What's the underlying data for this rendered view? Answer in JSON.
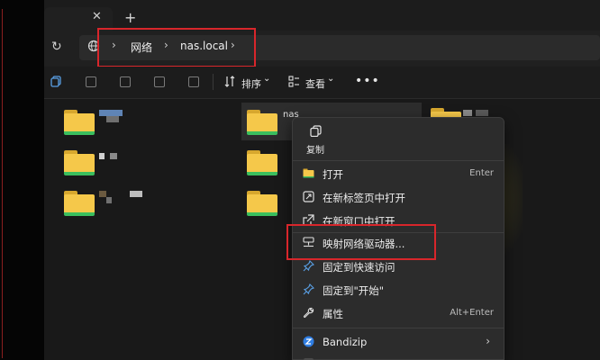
{
  "tab": {
    "close": "✕",
    "new": "+"
  },
  "address": {
    "refresh": "↻",
    "sep": "›",
    "crumbs": [
      "网络",
      "nas.local"
    ]
  },
  "toolbar": {
    "sort_label": "排序",
    "view_label": "查看",
    "more": "•••",
    "dropdown": "⌄"
  },
  "selected_item": {
    "name": "nas"
  },
  "context_menu": {
    "copy_label": "复制",
    "items": [
      {
        "label": "打开",
        "shortcut": "Enter",
        "icon": "folder-icon"
      },
      {
        "label": "在新标签页中打开",
        "shortcut": "",
        "icon": "new-tab-icon"
      },
      {
        "label": "在新窗口中打开",
        "shortcut": "",
        "icon": "new-window-icon"
      },
      {
        "label": "映射网络驱动器...",
        "shortcut": "",
        "icon": "network-drive-icon"
      },
      {
        "label": "固定到快速访问",
        "shortcut": "",
        "icon": "pin-icon"
      },
      {
        "label": "固定到\"开始\"",
        "shortcut": "",
        "icon": "pin-icon"
      },
      {
        "label": "属性",
        "shortcut": "Alt+Enter",
        "icon": "wrench-icon"
      },
      {
        "label": "Bandizip",
        "shortcut": "",
        "icon": "bandizip-icon",
        "submenu": "›"
      }
    ]
  },
  "colors": {
    "highlight": "#d8262b",
    "folder": "#f5c84a",
    "folder_stripe": "#3bbf5e",
    "accent": "#3b82f6"
  }
}
